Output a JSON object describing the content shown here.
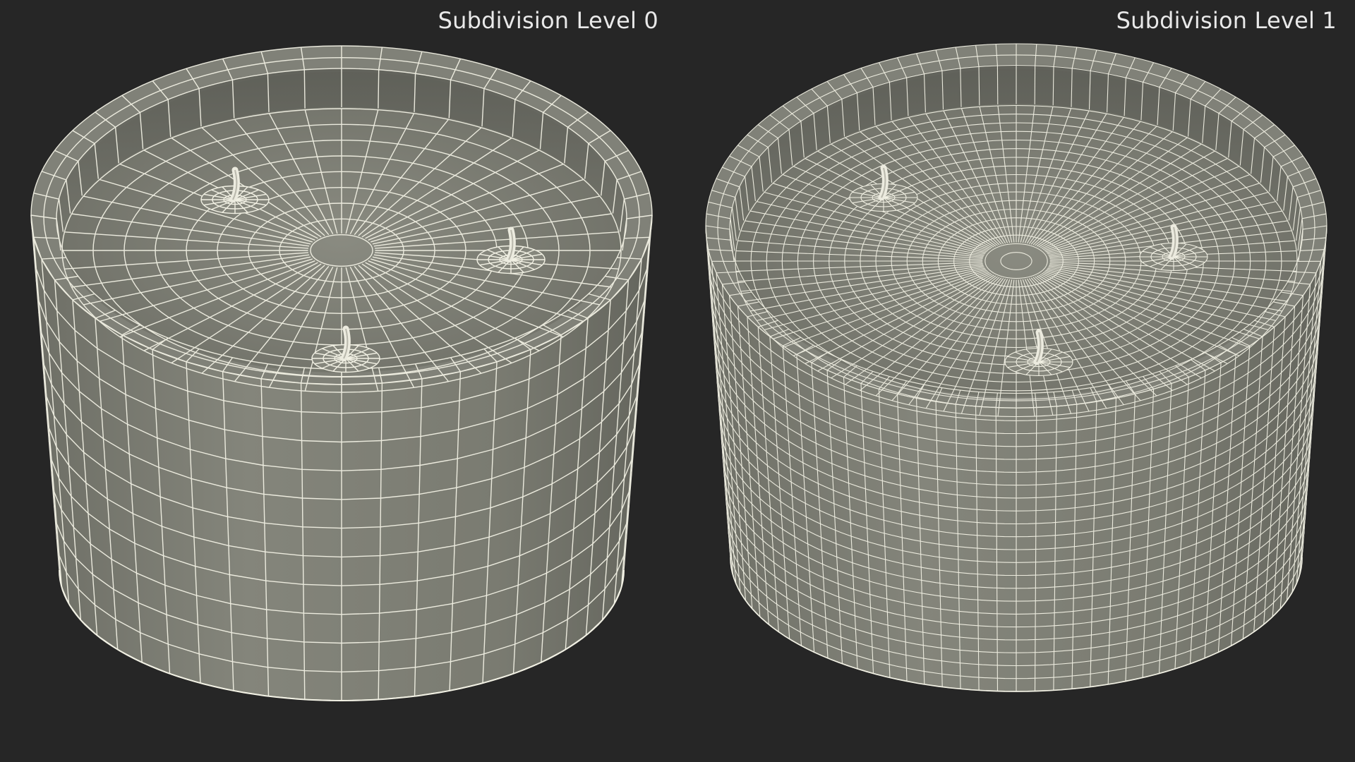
{
  "labels": {
    "left": "Subdivision Level 0",
    "right": "Subdivision Level 1"
  },
  "scene": {
    "background": "#262626",
    "mesh_fill": "#78796f",
    "wire_color": "#f2f1e4",
    "objects": [
      {
        "name": "candle-jar-subdivision-0",
        "wick_count": 3
      },
      {
        "name": "candle-jar-subdivision-1",
        "wick_count": 3
      }
    ]
  }
}
